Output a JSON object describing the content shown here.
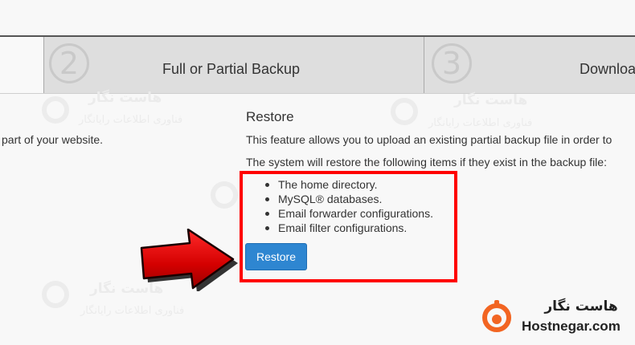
{
  "steps": [
    {
      "number": "2",
      "label": "Full or Partial Backup"
    },
    {
      "number": "3",
      "label": "Downloa"
    }
  ],
  "left_text": "part of your website.",
  "restore": {
    "title": "Restore",
    "intro": "This feature allows you to upload an existing partial backup file in order to",
    "items_intro": "The system will restore the following items if they exist in the backup file:",
    "items": [
      "The home directory.",
      "MySQL® databases.",
      "Email forwarder configurations.",
      "Email filter configurations."
    ],
    "button_label": "Restore"
  },
  "watermark": {
    "line1": "هاست نگار",
    "line2": "فناوری اطلاعات رایانگار"
  },
  "brand": {
    "fa": "هاست نگار",
    "en": "Hostnegar.com"
  },
  "colors": {
    "highlight": "#ff0000",
    "button": "#2e86d1",
    "arrow": "#d40000",
    "brand_orange": "#f26522"
  }
}
